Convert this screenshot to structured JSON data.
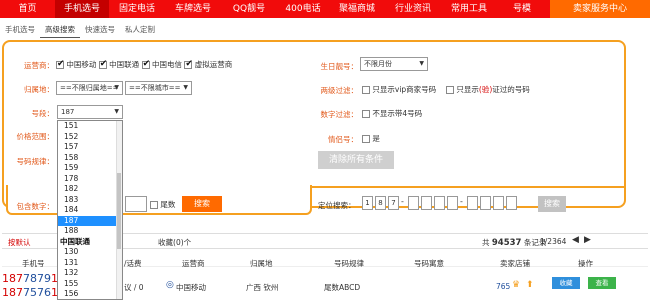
{
  "topnav": {
    "items": [
      "首页",
      "手机选号",
      "固定电话",
      "车牌选号",
      "QQ靓号",
      "400电话",
      "聚福商城",
      "行业资讯",
      "常用工具",
      "号模"
    ],
    "service": "卖家服务中心"
  },
  "subtabs": [
    "手机选号",
    "高级搜索",
    "快速选号",
    "私人定制"
  ],
  "filters": {
    "carrier_label": "运营商：",
    "carriers": [
      {
        "label": "中国移动",
        "checked": true
      },
      {
        "label": "中国联通",
        "checked": true
      },
      {
        "label": "中国电信",
        "checked": true
      },
      {
        "label": "虚拟运营商",
        "checked": true
      }
    ],
    "region_label": "归属地：",
    "province": "==不限归属地==",
    "city": "==不限城市==",
    "segment_label": "号段：",
    "segment_value": "187",
    "price_label": "价格范围：",
    "rule_label": "号码规律：",
    "contains_label": "包含数字：",
    "tail_label": "尾数",
    "search_label": "搜索",
    "birthday_label": "生日靓号：",
    "birthday_value": "不限月份",
    "twoway_label": "两级过滤：",
    "vip_label": "只显示vip商家号码",
    "verified_prefix": "只显示",
    "verified_red": "(验)",
    "verified_suffix": "证过的号码",
    "digit_filter_label": "数字过滤：",
    "no4_label": "不显示带4号码",
    "couple_label": "情侣号：",
    "couple_option": "是",
    "clear_label": "清除所有条件",
    "locate_label": "定位搜索：",
    "locate_digits": [
      "1",
      "8",
      "7",
      "",
      "",
      "",
      "",
      "",
      "",
      "",
      ""
    ],
    "locate_search_label": "搜索"
  },
  "dropdown": {
    "options": [
      {
        "t": "151"
      },
      {
        "t": "152"
      },
      {
        "t": "157"
      },
      {
        "t": "158"
      },
      {
        "t": "159"
      },
      {
        "t": "178"
      },
      {
        "t": "182"
      },
      {
        "t": "183"
      },
      {
        "t": "184"
      },
      {
        "t": "187",
        "sel": true
      },
      {
        "t": "188"
      },
      {
        "t": "中国联通",
        "grp": true
      },
      {
        "t": "130"
      },
      {
        "t": "131"
      },
      {
        "t": "132"
      },
      {
        "t": "155"
      },
      {
        "t": "156"
      }
    ]
  },
  "results": {
    "default_sort": "按默认",
    "fav_label": "收藏",
    "fav_count": "0",
    "fav_unit": "个",
    "total_prefix": "共",
    "total_count": "94537",
    "total_suffix": "条记录",
    "page": "1/2364"
  },
  "table": {
    "headers": [
      "手机号",
      "/话费",
      "运营商",
      "归属地",
      "号码规律",
      "号码寓意",
      "卖家店铺",
      "操作"
    ],
    "rows": [
      {
        "phone_red": "187",
        "phone_blue": "7879",
        "phone_rest": "12",
        "fee": "议 / 0",
        "carrier": "中国移动",
        "region": "广西 钦州",
        "rule": "尾数ABCD",
        "shop": "765",
        "fav": "收藏",
        "view": "查看"
      },
      {
        "phone_red": "187",
        "phone_blue": "7576",
        "phone_rest": "12",
        "fee": "",
        "carrier": "",
        "region": "",
        "rule": "",
        "shop": "",
        "fav": "",
        "view": ""
      }
    ]
  },
  "colors": {
    "nav_red": "#f10b0b",
    "accent_orange": "#ff6a00",
    "panel_border": "#f5a020",
    "label_orange": "#e25a1c",
    "select_blue": "#1e90ff"
  }
}
